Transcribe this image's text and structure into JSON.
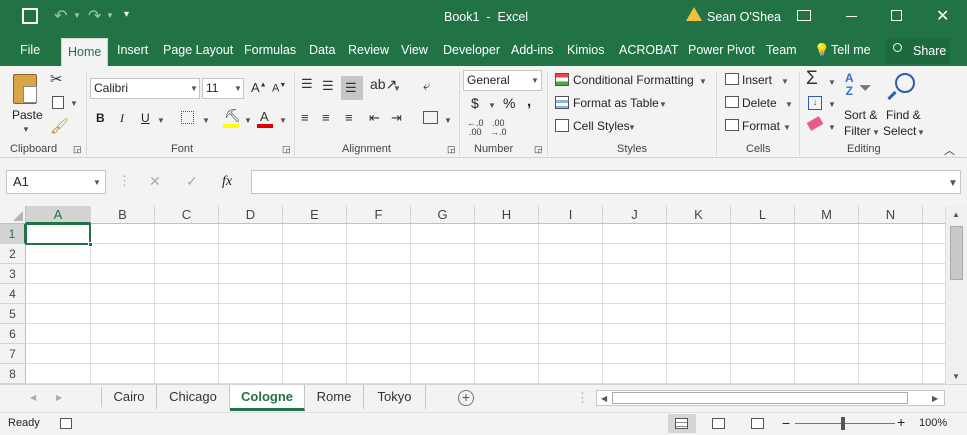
{
  "window": {
    "title": "Book1  -  Excel",
    "user": "Sean O'Shea",
    "share": "Share",
    "tell_me": "Tell me"
  },
  "tabs": [
    "File",
    "Home",
    "Insert",
    "Page Layout",
    "Formulas",
    "Data",
    "Review",
    "View",
    "Developer",
    "Add-ins",
    "Kimios",
    "ACROBAT",
    "Power Pivot",
    "Team"
  ],
  "ribbon": {
    "clipboard": {
      "label": "Clipboard",
      "paste": "Paste"
    },
    "font": {
      "label": "Font",
      "name": "Calibri",
      "size": "11",
      "bold": "B",
      "italic": "I",
      "underline": "U"
    },
    "alignment": {
      "label": "Alignment"
    },
    "number": {
      "label": "Number",
      "format": "General",
      "currency": "$",
      "percent": "%",
      "comma": ","
    },
    "styles": {
      "label": "Styles",
      "conditional": "Conditional Formatting",
      "table": "Format as Table",
      "cell": "Cell Styles"
    },
    "cells": {
      "label": "Cells",
      "insert": "Insert",
      "delete": "Delete",
      "format": "Format"
    },
    "editing": {
      "label": "Editing",
      "sort": "Sort &",
      "filter": "Filter",
      "find": "Find &",
      "select": "Select"
    }
  },
  "formula_bar": {
    "name_box": "A1",
    "fx": "fx",
    "value": ""
  },
  "grid": {
    "columns": [
      "A",
      "B",
      "C",
      "D",
      "E",
      "F",
      "G",
      "H",
      "I",
      "J",
      "K",
      "L",
      "M",
      "N"
    ],
    "rows": [
      "1",
      "2",
      "3",
      "4",
      "5",
      "6",
      "7",
      "8"
    ],
    "selected_cell": "A1"
  },
  "sheets": [
    "Cairo",
    "Chicago",
    "Cologne",
    "Rome",
    "Tokyo"
  ],
  "active_sheet": "Cologne",
  "status": {
    "state": "Ready",
    "zoom": "100%"
  },
  "colors": {
    "accent": "#217346"
  }
}
